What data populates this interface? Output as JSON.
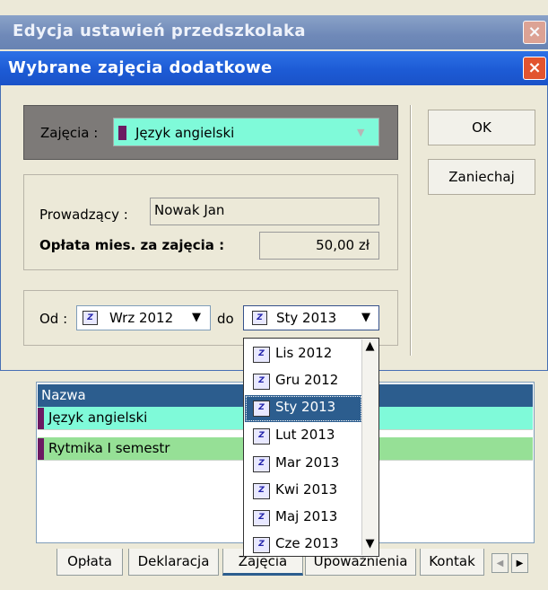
{
  "background_window": {
    "title": "Edycja ustawień przedszkolaka",
    "grid": {
      "header": "Nazwa",
      "rows": [
        {
          "name": "Język angielski",
          "color": "#7ffad9"
        },
        {
          "name": "Rytmika I semestr",
          "color": "#96e096"
        }
      ]
    },
    "tabs": [
      "Opłata",
      "Deklaracja",
      "Zajęcia",
      "Upoważnienia",
      "Kontak"
    ]
  },
  "dialog": {
    "title": "Wybrane zajęcia dodatkowe",
    "activity_label": "Zajęcia :",
    "activity_value": "Język angielski",
    "activity_color": "#7ffad9",
    "teacher_label": "Prowadzący :",
    "teacher_value": "Nowak Jan",
    "fee_label": "Opłata mies. za zajęcia :",
    "fee_value": "50,00 zł",
    "from_label": "Od :",
    "from_value": "Wrz 2012",
    "to_label": "do",
    "to_value": "Sty 2013",
    "ok_label": "OK",
    "cancel_label": "Zaniechaj"
  },
  "dropdown": {
    "items": [
      "Lis 2012",
      "Gru 2012",
      "Sty 2013",
      "Lut 2013",
      "Mar 2013",
      "Kwi 2013",
      "Maj 2013",
      "Cze 2013"
    ],
    "selected": "Sty 2013"
  },
  "icons": {
    "close": "×",
    "calendar": "Z",
    "arrow_down": "▼",
    "arrow_up": "▲",
    "arrow_left": "◀",
    "arrow_right": "▶"
  },
  "colors": {
    "dialog_titlebar": "#1d5bd5",
    "bg_titlebar": "#7a93c0",
    "selection": "#2c5d8e",
    "activity_swatch": "#6c1a62"
  }
}
